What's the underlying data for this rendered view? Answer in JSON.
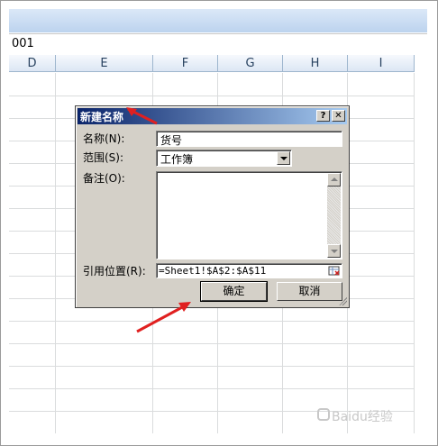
{
  "formula_bar": {
    "namebox": "001"
  },
  "columns": [
    "D",
    "E",
    "F",
    "G",
    "H",
    "I"
  ],
  "dialog": {
    "title": "新建名称",
    "help_label": "?",
    "close_label": "✕",
    "name_label": "名称(N):",
    "name_value": "货号",
    "scope_label": "范围(S):",
    "scope_value": "工作簿",
    "comment_label": "备注(O):",
    "comment_value": "",
    "refers_label": "引用位置(R):",
    "refers_value": "=Sheet1!$A$2:$A$11",
    "ok_label": "确定",
    "cancel_label": "取消"
  },
  "annotation_color": "#e02020",
  "watermark": {
    "text": "Baidu经验"
  }
}
